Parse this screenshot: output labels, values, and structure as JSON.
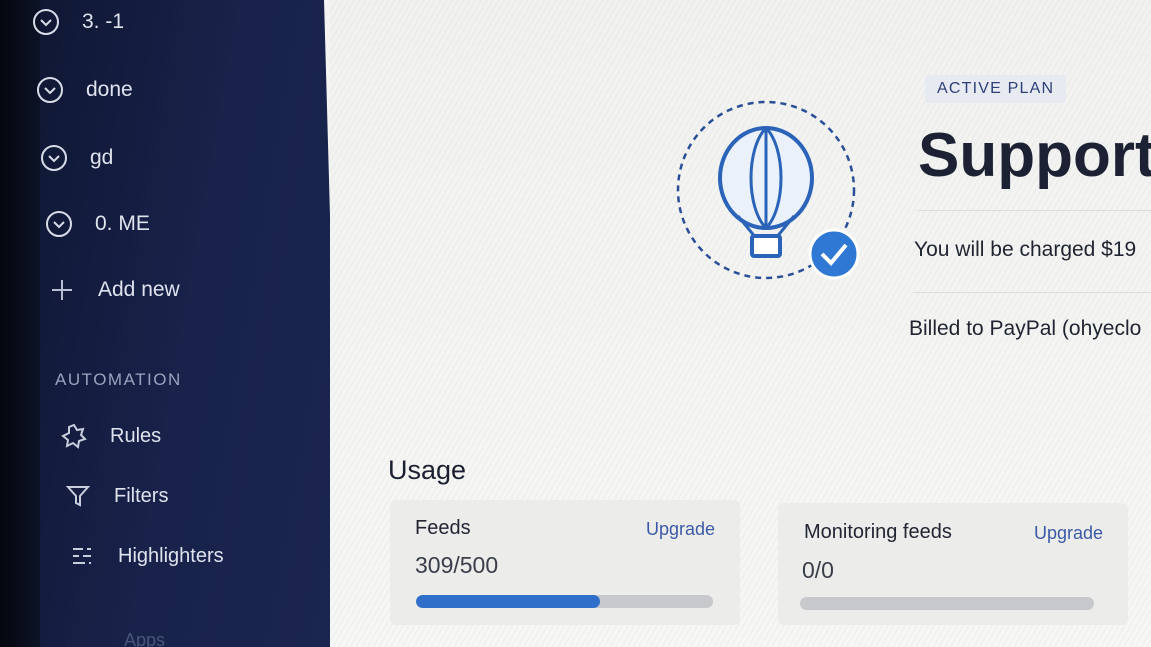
{
  "sidebar": {
    "items": [
      {
        "label": "3. -1",
        "icon": "chevron-down-circle-icon"
      },
      {
        "label": "done",
        "icon": "chevron-down-circle-icon"
      },
      {
        "label": "gd",
        "icon": "chevron-down-circle-icon"
      },
      {
        "label": "0. ME",
        "icon": "chevron-down-circle-icon"
      },
      {
        "label": "Add new",
        "icon": "plus-icon"
      }
    ],
    "automation_label": "AUTOMATION",
    "automation_items": [
      {
        "label": "Rules",
        "icon": "rules-gear-icon"
      },
      {
        "label": "Filters",
        "icon": "filter-icon"
      },
      {
        "label": "Highlighters",
        "icon": "highlighter-icon"
      }
    ],
    "apps_label": "Apps"
  },
  "plan": {
    "badge": "ACTIVE PLAN",
    "title": "Support",
    "charge_text": "You will be charged $19",
    "billed_text": "Billed to PayPal (ohyeclo"
  },
  "usage": {
    "title": "Usage",
    "cards": [
      {
        "label": "Feeds",
        "link": "Upgrade",
        "count": "309/500",
        "fraction": 0.618
      },
      {
        "label": "Monitoring feeds",
        "link": "Upgrade",
        "count": "0/0",
        "fraction": 0
      }
    ]
  },
  "colors": {
    "sidebar_bg": "#18224a",
    "accent": "#2f6fc9",
    "badge_text": "#2e3f78"
  }
}
